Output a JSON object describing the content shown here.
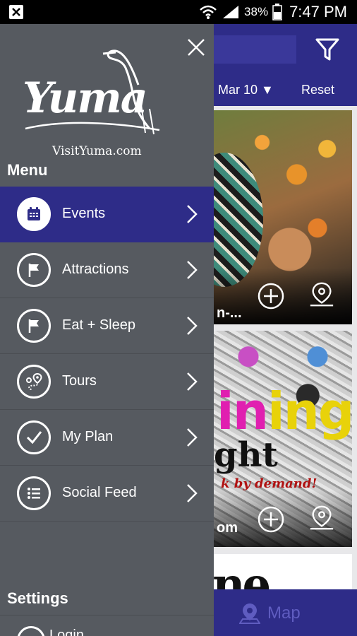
{
  "status_bar": {
    "battery_pct": "38%",
    "time": "7:47 PM"
  },
  "background": {
    "date_filter": "Mar 10 ▼",
    "reset_label": "Reset",
    "cards": [
      {
        "title_fragment": "n-..."
      },
      {
        "title_fragment": "om",
        "promo_word_1": "ing",
        "promo_word_2": "ght",
        "promo_tagline": "k by demand!"
      }
    ],
    "card3_fragment": "ne",
    "bottom_nav": {
      "map_label": "Map"
    }
  },
  "drawer": {
    "logo_word": "Yuma",
    "logo_sub": "VisitYuma.com",
    "menu_heading": "Menu",
    "items": [
      {
        "label": "Events",
        "icon": "calendar-icon",
        "active": true
      },
      {
        "label": "Attractions",
        "icon": "flag-icon",
        "active": false
      },
      {
        "label": "Eat + Sleep",
        "icon": "flag-icon",
        "active": false
      },
      {
        "label": "Tours",
        "icon": "route-pin-icon",
        "active": false
      },
      {
        "label": "My Plan",
        "icon": "checkmark-icon",
        "active": false
      },
      {
        "label": "Social Feed",
        "icon": "list-icon",
        "active": false
      }
    ],
    "settings_heading": "Settings",
    "login_label": "Login"
  },
  "colors": {
    "drawer_bg": "#565a60",
    "accent": "#2e2c88"
  }
}
